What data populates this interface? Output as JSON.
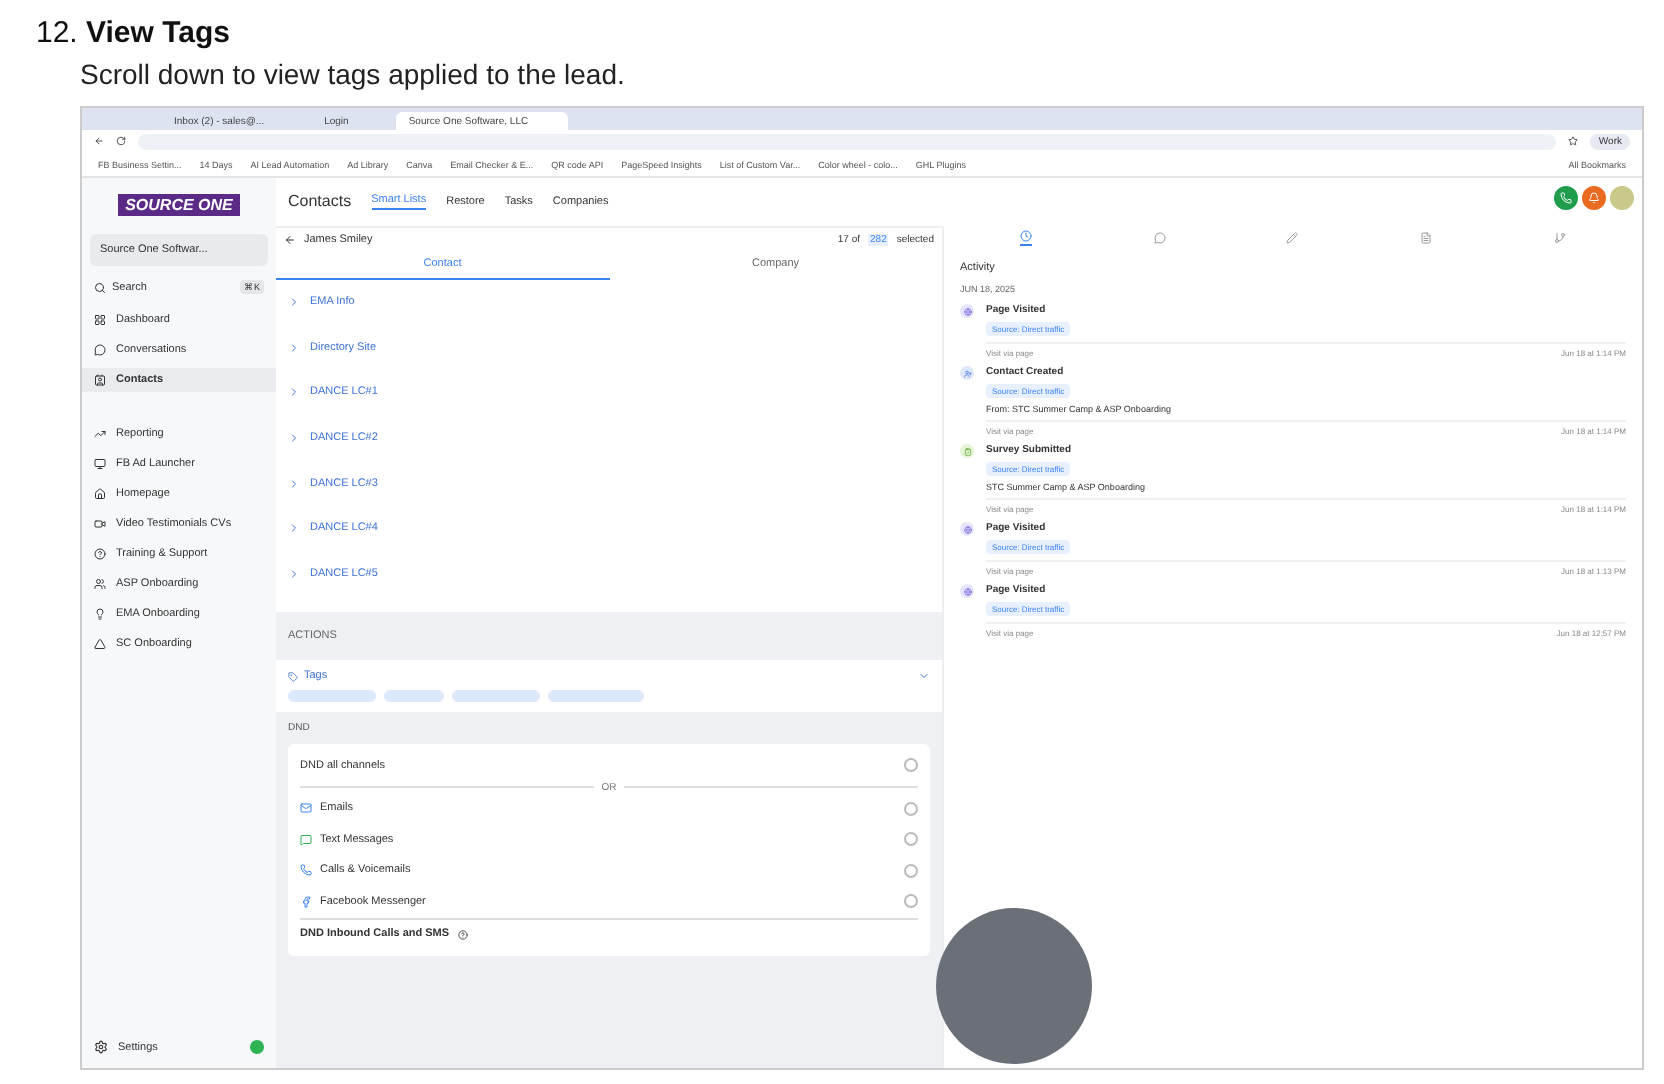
{
  "heading": "12. **View Tags**",
  "instruction": "Scroll down to view tags applied to the lead.",
  "browser": {
    "tabs": [
      {
        "label": "Inbox (2) - sales@...",
        "selected": false
      },
      {
        "label": "Login",
        "selected": false
      },
      {
        "label": "Source One Software, LLC",
        "selected": true
      }
    ],
    "bookmarks": [
      "FB Business Settin...",
      "14 Days",
      "AI Lead Automation",
      "Ad Library",
      "Canva",
      "Email Checker & E...",
      "QR code API",
      "PageSpeed Insights",
      "List of Custom Var...",
      "Color wheel - colo...",
      "GHL Plugins"
    ],
    "all_bookmarks": "All Bookmarks",
    "profile": "Work"
  },
  "sidebar": {
    "logo": "SOURCE ONE",
    "account": "Source One Softwar...",
    "search": "Search",
    "shortcut": "⌘K",
    "items": [
      {
        "label": "Dashboard",
        "selected": false
      },
      {
        "label": "Conversations",
        "selected": false
      },
      {
        "label": "Contacts",
        "selected": true
      },
      {
        "label": "Reporting",
        "selected": false
      },
      {
        "label": "FB Ad Launcher",
        "selected": false
      },
      {
        "label": "Homepage",
        "selected": false
      },
      {
        "label": "Video Testimonials CVs",
        "selected": false
      },
      {
        "label": "Training & Support",
        "selected": false
      },
      {
        "label": "ASP Onboarding",
        "selected": false
      },
      {
        "label": "EMA Onboarding",
        "selected": false
      },
      {
        "label": "SC Onboarding",
        "selected": false
      }
    ],
    "settings": "Settings"
  },
  "top_tabs": [
    {
      "label": "Contacts",
      "selected": false
    },
    {
      "label": "Smart Lists",
      "selected": true
    },
    {
      "label": "Restore",
      "selected": false
    },
    {
      "label": "Tasks",
      "selected": false
    },
    {
      "label": "Companies",
      "selected": false
    }
  ],
  "contact": {
    "name": "James Smiley",
    "pager": "17 of",
    "total": "282",
    "selected_label": "selected"
  },
  "sub_tabs": [
    {
      "label": "Contact",
      "selected": true
    },
    {
      "label": "Company",
      "selected": false
    }
  ],
  "sections": [
    "EMA Info",
    "Directory Site",
    "DANCE LC#1",
    "DANCE LC#2",
    "DANCE LC#3",
    "DANCE LC#4",
    "DANCE LC#5"
  ],
  "actions": {
    "title": "ACTIONS",
    "tags_label": "Tags",
    "tags_expanded": true
  },
  "dnd": {
    "title": "DND",
    "all": "DND all channels",
    "checked": false,
    "or": "OR",
    "channels": [
      {
        "kind": "email",
        "label": "Emails",
        "checked": false
      },
      {
        "kind": "sms",
        "label": "Text Messages",
        "checked": false
      },
      {
        "kind": "call",
        "label": "Calls & Voicemails",
        "checked": false
      },
      {
        "kind": "messenger",
        "label": "Facebook Messenger",
        "checked": false
      }
    ],
    "inbound": "DND Inbound Calls and SMS"
  },
  "panel_tabs": [
    {
      "kind": "clock",
      "selected": true
    },
    {
      "kind": "chat",
      "selected": false
    },
    {
      "kind": "pencil",
      "selected": false
    },
    {
      "kind": "document",
      "selected": false
    },
    {
      "kind": "branch",
      "selected": false
    }
  ],
  "activity": {
    "title": "Activity",
    "date": "JUN 18, 2025",
    "events": [
      {
        "kind": "page",
        "title": "Page Visited",
        "source": "Source: Direct traffic",
        "link": "Visit via page",
        "time": "Jun 18 at 1:14 PM"
      },
      {
        "kind": "contact",
        "title": "Contact Created",
        "source": "Source: Direct traffic",
        "detail": "From: STC Summer Camp & ASP Onboarding",
        "link": "Visit via page",
        "time": "Jun 18 at 1:14 PM"
      },
      {
        "kind": "survey",
        "title": "Survey Submitted",
        "source": "Source: Direct traffic",
        "detail": "STC Summer Camp & ASP Onboarding",
        "link": "Visit via page",
        "time": "Jun 18 at 1:14 PM"
      },
      {
        "kind": "page",
        "title": "Page Visited",
        "source": "Source: Direct traffic",
        "link": "Visit via page",
        "time": "Jun 18 at 1:13 PM"
      },
      {
        "kind": "page",
        "title": "Page Visited",
        "source": "Source: Direct traffic",
        "link": "Visit via page",
        "time": "Jun 18 at 12:57 PM"
      }
    ]
  }
}
